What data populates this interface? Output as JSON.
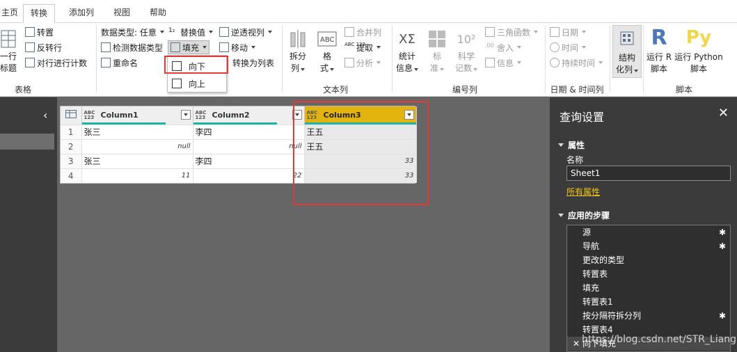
{
  "tabs": [
    "主页",
    "转换",
    "添加列",
    "视图",
    "帮助"
  ],
  "active_tab": "转换",
  "ribbon": {
    "table_group": {
      "label": "表格",
      "use_first_row_line1": "一行",
      "use_first_row_line2": "标题",
      "transpose": "转置",
      "reverse_rows": "反转行",
      "count_rows": "对行进行计数"
    },
    "any_column_group": {
      "data_type": "数据类型: 任意",
      "detect_type": "检测数据类型",
      "rename": "重命名",
      "replace_values": "替换值",
      "fill": "填充",
      "unpivot": "逆透视列",
      "move": "移动",
      "to_list": "转换为列表"
    },
    "fill_menu": {
      "down": "向下",
      "up": "向上"
    },
    "text_column_group": {
      "label": "文本列",
      "split_line1": "拆分",
      "split_line2": "列",
      "format_line1": "格",
      "format_line2": "式",
      "merge": "合并列",
      "extract": "提取",
      "parse": "分析"
    },
    "number_column_group": {
      "label": "编号列",
      "stats_line1": "统计",
      "stats_line2": "信息",
      "standard_line1": "标",
      "standard_line2": "准",
      "scientific_line1": "科学",
      "scientific_line2": "记数",
      "trig": "三角函数",
      "rounding": "舍入",
      "info": "信息"
    },
    "datetime_group": {
      "label": "日期 & 时间列",
      "date": "日期",
      "time": "时间",
      "duration": "持续时间"
    },
    "structured_group": {
      "line1": "结构",
      "line2": "化列"
    },
    "scripts_group": {
      "label": "脚本",
      "run_r_line1": "运行 R",
      "run_r_line2": "脚本",
      "run_py_line1": "运行 Python",
      "run_py_line2": "脚本"
    }
  },
  "grid": {
    "columns": [
      {
        "type": "ABC\n123",
        "name": "Column1"
      },
      {
        "type": "ABC\n123",
        "name": "Column2"
      },
      {
        "type": "ABC\n123",
        "name": "Column3"
      }
    ],
    "rows": [
      {
        "n": "1",
        "c1": "张三",
        "c2": "李四",
        "c3": "王五"
      },
      {
        "n": "2",
        "c1": "null",
        "c2": "null",
        "c3": "王五"
      },
      {
        "n": "3",
        "c1": "张三",
        "c2": "李四",
        "c3": "33"
      },
      {
        "n": "4",
        "c1": "11",
        "c2": "22",
        "c3": "33"
      }
    ]
  },
  "query_settings": {
    "title": "查询设置",
    "properties_label": "属性",
    "name_label": "名称",
    "name_value": "Sheet1",
    "all_properties": "所有属性",
    "applied_steps_label": "应用的步骤",
    "steps": [
      "源",
      "导航",
      "更改的类型",
      "转置表",
      "填充",
      "转置表1",
      "按分隔符拆分列",
      "转置表4",
      "向下填充"
    ]
  },
  "watermark": "https://blog.csdn.net/STR_Liang",
  "colors": {
    "accent_yellow": "#e3b40d",
    "quality_bar": "#1fb3a6",
    "highlight_red": "#e53935",
    "link": "#f2c811"
  }
}
